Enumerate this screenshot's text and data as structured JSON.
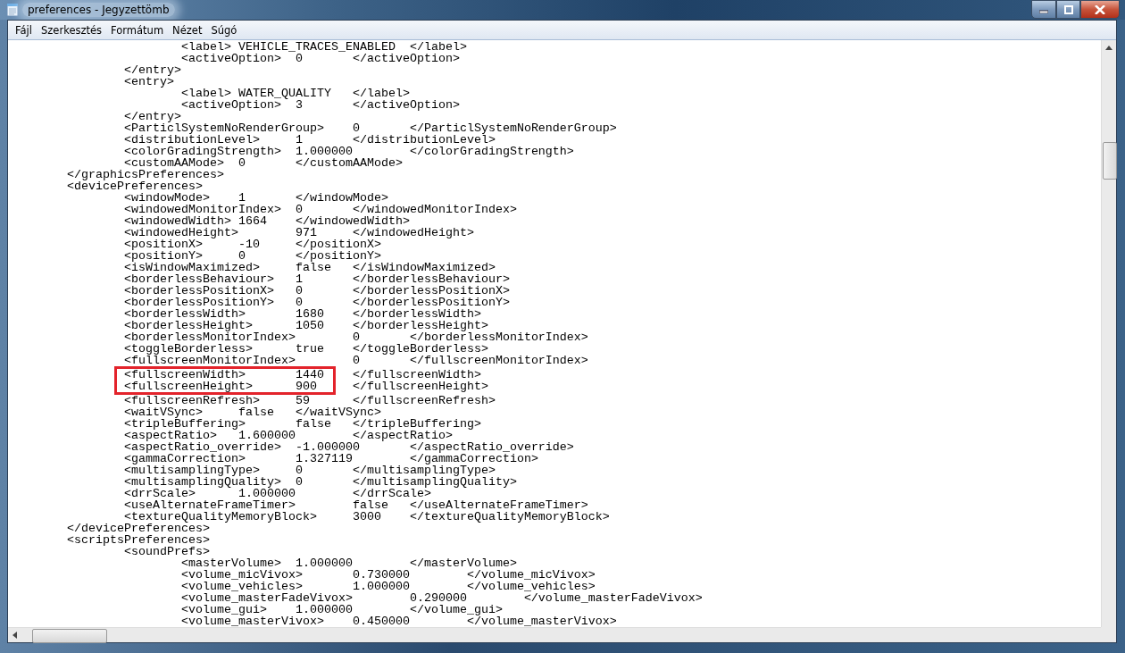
{
  "window": {
    "title": "preferences - Jegyzettömb"
  },
  "menu": [
    "Fájl",
    "Szerkesztés",
    "Formátum",
    "Nézet",
    "Súgó"
  ],
  "lines": [
    {
      "text": "\t\t\t<label> VEHICLE_TRACES_ENABLED\t</label>",
      "highlighted": false
    },
    {
      "text": "\t\t\t<activeOption>\t0\t</activeOption>",
      "highlighted": false
    },
    {
      "text": "\t\t</entry>",
      "highlighted": false
    },
    {
      "text": "\t\t<entry>",
      "highlighted": false
    },
    {
      "text": "\t\t\t<label> WATER_QUALITY\t</label>",
      "highlighted": false
    },
    {
      "text": "\t\t\t<activeOption>\t3\t</activeOption>",
      "highlighted": false
    },
    {
      "text": "\t\t</entry>",
      "highlighted": false
    },
    {
      "text": "\t\t<ParticlSystemNoRenderGroup>\t0\t</ParticlSystemNoRenderGroup>",
      "highlighted": false
    },
    {
      "text": "\t\t<distributionLevel>\t1\t</distributionLevel>",
      "highlighted": false
    },
    {
      "text": "\t\t<colorGradingStrength>\t1.000000\t</colorGradingStrength>",
      "highlighted": false
    },
    {
      "text": "\t\t<customAAMode>\t0\t</customAAMode>",
      "highlighted": false
    },
    {
      "text": "\t</graphicsPreferences>",
      "highlighted": false
    },
    {
      "text": "\t<devicePreferences>",
      "highlighted": false
    },
    {
      "text": "\t\t<windowMode>\t1\t</windowMode>",
      "highlighted": false
    },
    {
      "text": "\t\t<windowedMonitorIndex>\t0\t</windowedMonitorIndex>",
      "highlighted": false
    },
    {
      "text": "\t\t<windowedWidth> 1664\t</windowedWidth>",
      "highlighted": false
    },
    {
      "text": "\t\t<windowedHeight>\t971\t</windowedHeight>",
      "highlighted": false
    },
    {
      "text": "\t\t<positionX>\t-10\t</positionX>",
      "highlighted": false
    },
    {
      "text": "\t\t<positionY>\t0\t</positionY>",
      "highlighted": false
    },
    {
      "text": "\t\t<isWindowMaximized>\tfalse\t</isWindowMaximized>",
      "highlighted": false
    },
    {
      "text": "\t\t<borderlessBehaviour>\t1\t</borderlessBehaviour>",
      "highlighted": false
    },
    {
      "text": "\t\t<borderlessPositionX>\t0\t</borderlessPositionX>",
      "highlighted": false
    },
    {
      "text": "\t\t<borderlessPositionY>\t0\t</borderlessPositionY>",
      "highlighted": false
    },
    {
      "text": "\t\t<borderlessWidth>\t1680\t</borderlessWidth>",
      "highlighted": false
    },
    {
      "text": "\t\t<borderlessHeight>\t1050\t</borderlessHeight>",
      "highlighted": false
    },
    {
      "text": "\t\t<borderlessMonitorIndex>\t0\t</borderlessMonitorIndex>",
      "highlighted": false
    },
    {
      "text": "\t\t<toggleBorderless>\ttrue\t</toggleBorderless>",
      "highlighted": false
    },
    {
      "text": "\t\t<fullscreenMonitorIndex>\t0\t</fullscreenMonitorIndex>",
      "highlighted": false
    },
    {
      "text": "\t\t<fullscreenWidth>\t1440\t</fullscreenWidth>",
      "highlighted": true
    },
    {
      "text": "\t\t<fullscreenHeight>\t900\t</fullscreenHeight>",
      "highlighted": true
    },
    {
      "text": "\t\t<fullscreenRefresh>\t59\t</fullscreenRefresh>",
      "highlighted": false
    },
    {
      "text": "\t\t<waitVSync>\tfalse\t</waitVSync>",
      "highlighted": false
    },
    {
      "text": "\t\t<tripleBuffering>\tfalse\t</tripleBuffering>",
      "highlighted": false
    },
    {
      "text": "\t\t<aspectRatio>\t1.600000\t</aspectRatio>",
      "highlighted": false
    },
    {
      "text": "\t\t<aspectRatio_override>\t-1.000000\t</aspectRatio_override>",
      "highlighted": false
    },
    {
      "text": "\t\t<gammaCorrection>\t1.327119\t</gammaCorrection>",
      "highlighted": false
    },
    {
      "text": "\t\t<multisamplingType>\t0\t</multisamplingType>",
      "highlighted": false
    },
    {
      "text": "\t\t<multisamplingQuality>\t0\t</multisamplingQuality>",
      "highlighted": false
    },
    {
      "text": "\t\t<drrScale>\t1.000000\t</drrScale>",
      "highlighted": false
    },
    {
      "text": "\t\t<useAlternateFrameTimer>\tfalse\t</useAlternateFrameTimer>",
      "highlighted": false
    },
    {
      "text": "\t\t<textureQualityMemoryBlock>\t3000\t</textureQualityMemoryBlock>",
      "highlighted": false
    },
    {
      "text": "\t</devicePreferences>",
      "highlighted": false
    },
    {
      "text": "\t<scriptsPreferences>",
      "highlighted": false
    },
    {
      "text": "\t\t<soundPrefs>",
      "highlighted": false
    },
    {
      "text": "\t\t\t<masterVolume>\t1.000000\t</masterVolume>",
      "highlighted": false
    },
    {
      "text": "\t\t\t<volume_micVivox>\t0.730000\t</volume_micVivox>",
      "highlighted": false
    },
    {
      "text": "\t\t\t<volume_vehicles>\t1.000000\t</volume_vehicles>",
      "highlighted": false
    },
    {
      "text": "\t\t\t<volume_masterFadeVivox>\t0.290000\t</volume_masterFadeVivox>",
      "highlighted": false
    },
    {
      "text": "\t\t\t<volume_gui>\t1.000000\t</volume_gui>",
      "highlighted": false
    },
    {
      "text": "\t\t\t<volume_masterVivox>\t0.450000\t</volume_masterVivox>",
      "highlighted": false
    }
  ]
}
